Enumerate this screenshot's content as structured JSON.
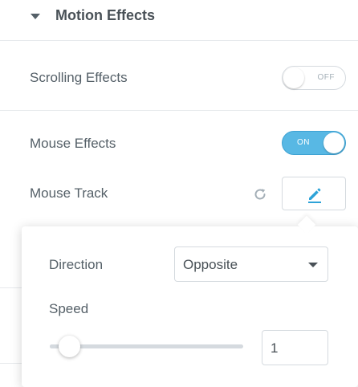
{
  "section": {
    "title": "Motion Effects"
  },
  "scrolling_effects": {
    "label": "Scrolling Effects",
    "state": "OFF",
    "enabled": false
  },
  "mouse_effects": {
    "label": "Mouse Effects",
    "state": "ON",
    "enabled": true
  },
  "mouse_track": {
    "label": "Mouse Track"
  },
  "popover": {
    "direction_label": "Direction",
    "direction_value": "Opposite",
    "speed_label": "Speed",
    "speed_value": "1",
    "speed_slider_fraction": 0.1
  },
  "colors": {
    "accent": "#58b8e4",
    "edit_icon": "#2ea3d8",
    "text": "#556068",
    "border": "#d5dadf"
  },
  "icons": {
    "section_toggle": "caret-down-icon",
    "reset": "reset-icon",
    "edit": "pencil-icon",
    "select": "caret-down-icon"
  }
}
